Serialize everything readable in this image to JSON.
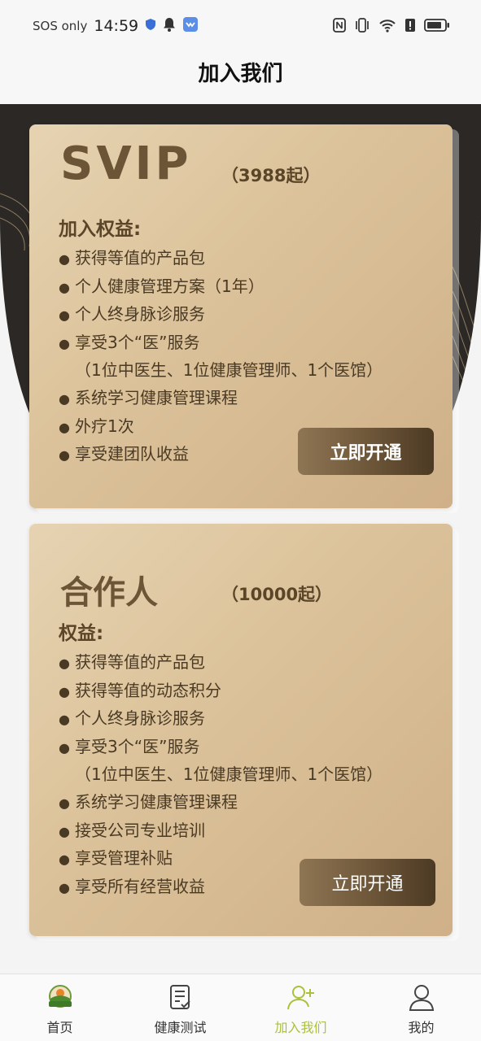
{
  "status_bar": {
    "carrier": "SOS only",
    "time": "14:59",
    "icons": [
      "shield-icon",
      "bell-icon",
      "app-notification-icon",
      "nfc-icon",
      "vibrate-icon",
      "wifi-icon",
      "alert-icon",
      "battery-icon"
    ]
  },
  "header": {
    "title": "加入我们"
  },
  "colors": {
    "accent_active": "#a9c23a",
    "card_gold": "#dcc39b",
    "button_brown": "#6c5538",
    "backdrop": "#2b2825"
  },
  "cards": [
    {
      "name": "SVIP",
      "price": "（3988起）",
      "benefit_title": "加入权益:",
      "benefits": [
        "获得等值的产品包",
        "个人健康管理方案（1年）",
        "个人终身脉诊服务",
        "享受3个“医”服务",
        "（1位中医生、1位健康管理师、1个医馆）",
        "系统学习健康管理课程",
        "外疗1次",
        "享受建团队收益"
      ],
      "button_label": "立即开通"
    },
    {
      "name": "合作人",
      "price": "（10000起）",
      "benefit_title": "权益:",
      "benefits": [
        "获得等值的产品包",
        "获得等值的动态积分",
        "个人终身脉诊服务",
        "享受3个“医”服务",
        "（1位中医生、1位健康管理师、1个医馆）",
        "系统学习健康管理课程",
        "接受公司专业培训",
        "享受管理补贴",
        "享受所有经营收益"
      ],
      "button_label": "立即开通"
    }
  ],
  "bullet": "●",
  "bottom_nav": [
    {
      "label": "首页",
      "icon": "home-logo-icon",
      "active": false
    },
    {
      "label": "健康测试",
      "icon": "checklist-icon",
      "active": false
    },
    {
      "label": "加入我们",
      "icon": "add-user-icon",
      "active": true
    },
    {
      "label": "我的",
      "icon": "profile-icon",
      "active": false
    }
  ]
}
